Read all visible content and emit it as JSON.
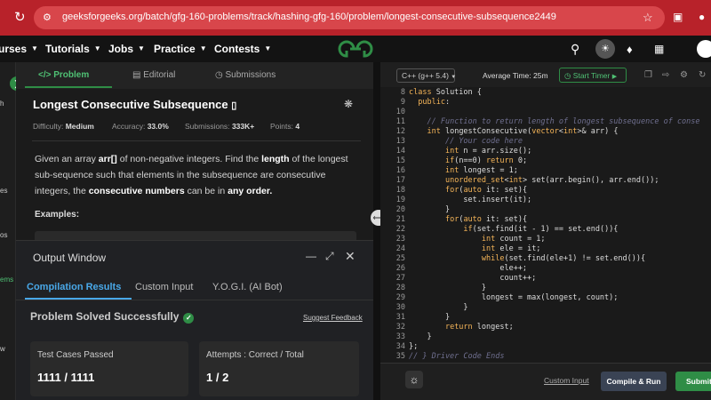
{
  "browser": {
    "url": "geeksforgeeks.org/batch/gfg-160-problems/track/hashing-gfg-160/problem/longest-consecutive-subsequence2449"
  },
  "nav": {
    "items": [
      "urses",
      "Tutorials",
      "Jobs",
      "Practice",
      "Contests"
    ]
  },
  "rail": [
    "h",
    "es",
    "os",
    "ems",
    "w"
  ],
  "problem": {
    "tabs": [
      "Problem",
      "Editorial",
      "Submissions"
    ],
    "title": "Longest Consecutive Subsequence",
    "difficulty_label": "Difficulty:",
    "difficulty": "Medium",
    "accuracy_label": "Accuracy:",
    "accuracy": "33.0%",
    "submissions_label": "Submissions:",
    "submissions": "333K+",
    "points_label": "Points:",
    "points": "4",
    "desc": {
      "p1": "Given an array ",
      "arr": "arr[]",
      "p2": " of non-negative integers. Find the ",
      "length": "length",
      "p3": " of the longest sub-sequence such that elements in the subsequence are consecutive integers, the ",
      "consecutive": "consecutive numbers",
      "p4": " can be in ",
      "anyorder": "any order.",
      "p5": ""
    },
    "examples": "Examples:"
  },
  "output": {
    "title": "Output Window",
    "tabs": [
      "Compilation Results",
      "Custom Input",
      "Y.O.G.I. (AI Bot)"
    ],
    "status": "Problem Solved Successfully",
    "feedback": "Suggest Feedback",
    "tests_label": "Test Cases Passed",
    "tests_value": "1111 / 1111",
    "attempts_label": "Attempts : Correct / Total",
    "attempts_value": "1 / 2"
  },
  "editor": {
    "language": "C++ (g++ 5.4)",
    "avg_time": "Average Time: 25m",
    "timer": "Start Timer",
    "lines": [
      {
        "n": "8",
        "t": "class Solution {"
      },
      {
        "n": "9",
        "t": "  public:"
      },
      {
        "n": "10",
        "t": ""
      },
      {
        "n": "11",
        "t": "    // Function to return length of longest subsequence of conse"
      },
      {
        "n": "12",
        "t": "    int longestConsecutive(vector<int>& arr) {"
      },
      {
        "n": "13",
        "t": "        // Your code here"
      },
      {
        "n": "14",
        "t": "        int n = arr.size();"
      },
      {
        "n": "15",
        "t": "        if(n==0) return 0;"
      },
      {
        "n": "16",
        "t": "        int longest = 1;"
      },
      {
        "n": "17",
        "t": "        unordered_set<int> set(arr.begin(), arr.end());"
      },
      {
        "n": "18",
        "t": "        for(auto it: set){"
      },
      {
        "n": "19",
        "t": "            set.insert(it);"
      },
      {
        "n": "20",
        "t": "        }"
      },
      {
        "n": "21",
        "t": "        for(auto it: set){"
      },
      {
        "n": "22",
        "t": "            if(set.find(it - 1) == set.end()){"
      },
      {
        "n": "23",
        "t": "                int count = 1;"
      },
      {
        "n": "24",
        "t": "                int ele = it;"
      },
      {
        "n": "25",
        "t": "                while(set.find(ele+1) != set.end()){"
      },
      {
        "n": "26",
        "t": "                    ele++;"
      },
      {
        "n": "27",
        "t": "                    count++;"
      },
      {
        "n": "28",
        "t": "                }"
      },
      {
        "n": "29",
        "t": "                longest = max(longest, count);"
      },
      {
        "n": "30",
        "t": "            }"
      },
      {
        "n": "31",
        "t": "        }"
      },
      {
        "n": "32",
        "t": "        return longest;"
      },
      {
        "n": "33",
        "t": "    }"
      },
      {
        "n": "34",
        "t": "};"
      },
      {
        "n": "35",
        "t": "// } Driver Code Ends"
      }
    ],
    "custom_input": "Custom Input",
    "compile": "Compile & Run",
    "submit": "Submit"
  },
  "colors": {
    "accent_green": "#2f8d46",
    "browser_red": "#b8222a",
    "tab_blue": "#49a8e8"
  }
}
